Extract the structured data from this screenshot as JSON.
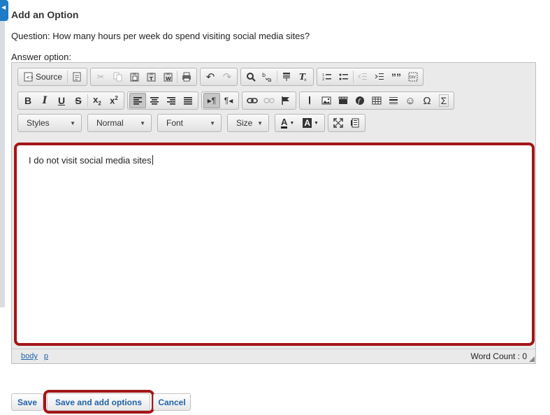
{
  "page": {
    "title": "Add an Option",
    "question": "Question: How many hours per week do spend visiting social media sites?",
    "answer_label": "Answer option:"
  },
  "toolbar": {
    "source_label": "Source",
    "styles_label": "Styles",
    "format_label": "Normal",
    "font_label": "Font",
    "size_label": "Size",
    "text_color_label": "A",
    "bg_color_label": "A",
    "bold": "B",
    "italic": "I",
    "underline": "U",
    "strike": "S",
    "blockquote": "””",
    "omega": "Ω",
    "sigma": "Σ"
  },
  "editor": {
    "content": "I do not visit social media sites",
    "path": [
      "body",
      "p"
    ],
    "word_count": "Word Count : 0"
  },
  "buttons": {
    "save": "Save",
    "save_add": "Save and add options",
    "cancel": "Cancel"
  },
  "colors": {
    "highlight": "#a31618",
    "link": "#1f63a8"
  }
}
